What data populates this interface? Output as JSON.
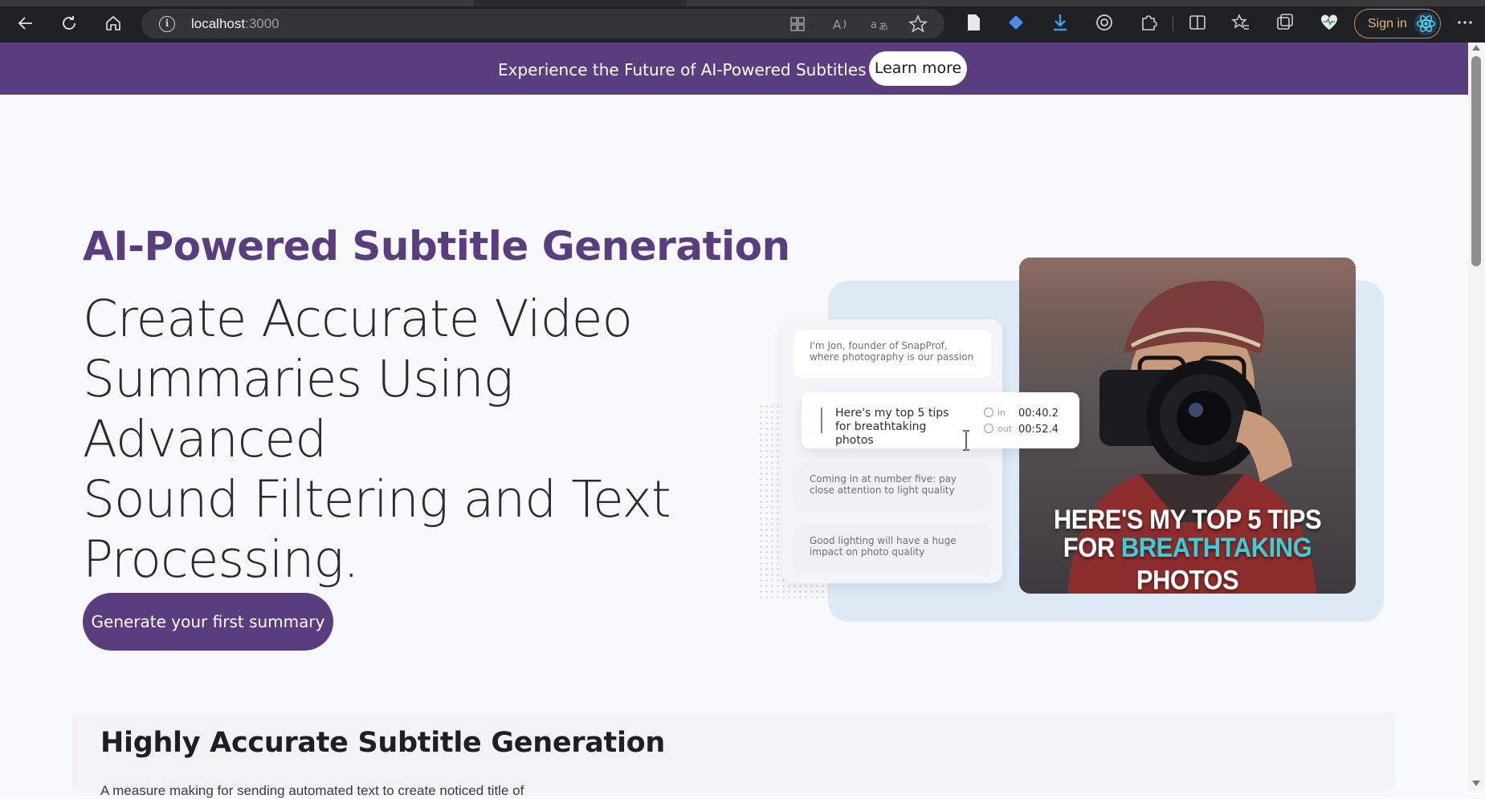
{
  "browser": {
    "url_host": "localhost",
    "url_port": ":3000",
    "signin_label": "Sign in"
  },
  "banner": {
    "message": "Experience the Future of AI-Powered Subtitles 🚀",
    "button_label": "Learn more"
  },
  "hero": {
    "eyebrow": "AI-Powered Subtitle Generation",
    "headline_lines": [
      "Create Accurate Video",
      "Summaries Using Advanced",
      "Sound Filtering and Text",
      "Processing."
    ],
    "cta_label": "Generate your first summary"
  },
  "illustration": {
    "cards": [
      "I'm Jon, founder of SnapProf, where photography is our passion",
      "Coming in at number five: pay close attention to light quality",
      "Good lighting will have a huge impact on photo quality"
    ],
    "active": {
      "text": "Here's my top 5 tips for breathtaking photos",
      "in_label": "in",
      "out_label": "out",
      "in_time": "00:40.2",
      "out_time": "00:52.4"
    },
    "caption_line1": "HERE'S MY TOP 5 TIPS",
    "caption_for": "FOR",
    "caption_highlight": "BREATHTAKING",
    "caption_end": "PHOTOS",
    "highlight_color": "#36d1d8"
  },
  "section": {
    "title": "Highly Accurate Subtitle Generation",
    "partial_text": "A measure making for sending automated text to create noticed title of"
  },
  "colors": {
    "brand": "#5a3d7e",
    "accent": "#9b6bd6"
  }
}
